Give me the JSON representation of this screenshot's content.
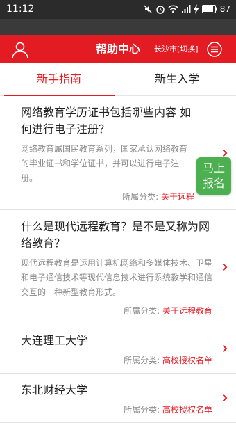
{
  "status_bar": {
    "time": "11:12",
    "battery": "87"
  },
  "header": {
    "title": "帮助中心",
    "city": "长沙市[切换]"
  },
  "tabs": [
    {
      "label": "新手指南",
      "active": true
    },
    {
      "label": "新生入学",
      "active": false
    }
  ],
  "list": {
    "category_label": "所属分类:",
    "items": [
      {
        "title": "网络教育学历证书包括哪些内容 如何进行电子注册？",
        "desc": "网络教育属国民教育系列，国家承认网络教育的毕业证书和学位证书，并可以进行电子注册。",
        "category": "关于远程"
      },
      {
        "title": "什么是现代远程教育？是不是又称为网络教育？",
        "desc": "现代远程教育是运用计算机网络和多媒体技术、卫星和电子通信技术等现代信息技术进行系统教学和通信交互的一种新型教育形式。",
        "category": "关于远程教育"
      },
      {
        "title": "大连理工大学",
        "category": "高校授权名单"
      },
      {
        "title": "东北财经大学",
        "category": "高校授权名单"
      }
    ]
  },
  "float_button": {
    "line1": "马上",
    "line2": "报名"
  },
  "colors": {
    "accent": "#e31b23",
    "float_button": "#4caf50"
  }
}
